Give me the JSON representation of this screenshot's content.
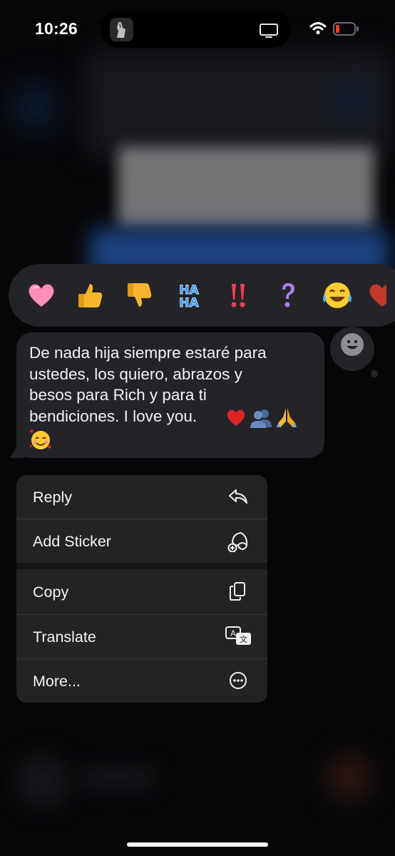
{
  "status_bar": {
    "time": "10:26"
  },
  "reactions": [
    {
      "icon": "heart-icon",
      "color": "#ff8fb8"
    },
    {
      "icon": "thumbs-up-icon",
      "color": "#f5b52e"
    },
    {
      "icon": "thumbs-down-icon",
      "color": "#f5b52e"
    },
    {
      "icon": "haha-icon",
      "text": "HA HA",
      "color": "#3aa6ff"
    },
    {
      "icon": "double-exclamation-icon",
      "color": "#ff3b5c"
    },
    {
      "icon": "question-icon",
      "color": "#b07cf0"
    },
    {
      "icon": "tears-of-joy-icon",
      "color": "#ffcc33"
    },
    {
      "icon": "heart-partial-icon",
      "color": "#c0392b"
    }
  ],
  "message": {
    "line1": "De  nada hija siempre estaré para",
    "line2": "ustedes, los quiero, abrazos y",
    "line3": "besos para Rich y para ti",
    "line4": "bendiciones. I love you.",
    "emojis": [
      "red-heart",
      "busts-in-silhouette",
      "folded-hands",
      "smiling-face-with-hearts"
    ]
  },
  "menu": {
    "reply": "Reply",
    "add_sticker": "Add Sticker",
    "copy": "Copy",
    "translate": "Translate",
    "more": "More..."
  },
  "colors": {
    "bubble": "#242428",
    "menu": "#232326",
    "text": "#f5f5f7"
  }
}
